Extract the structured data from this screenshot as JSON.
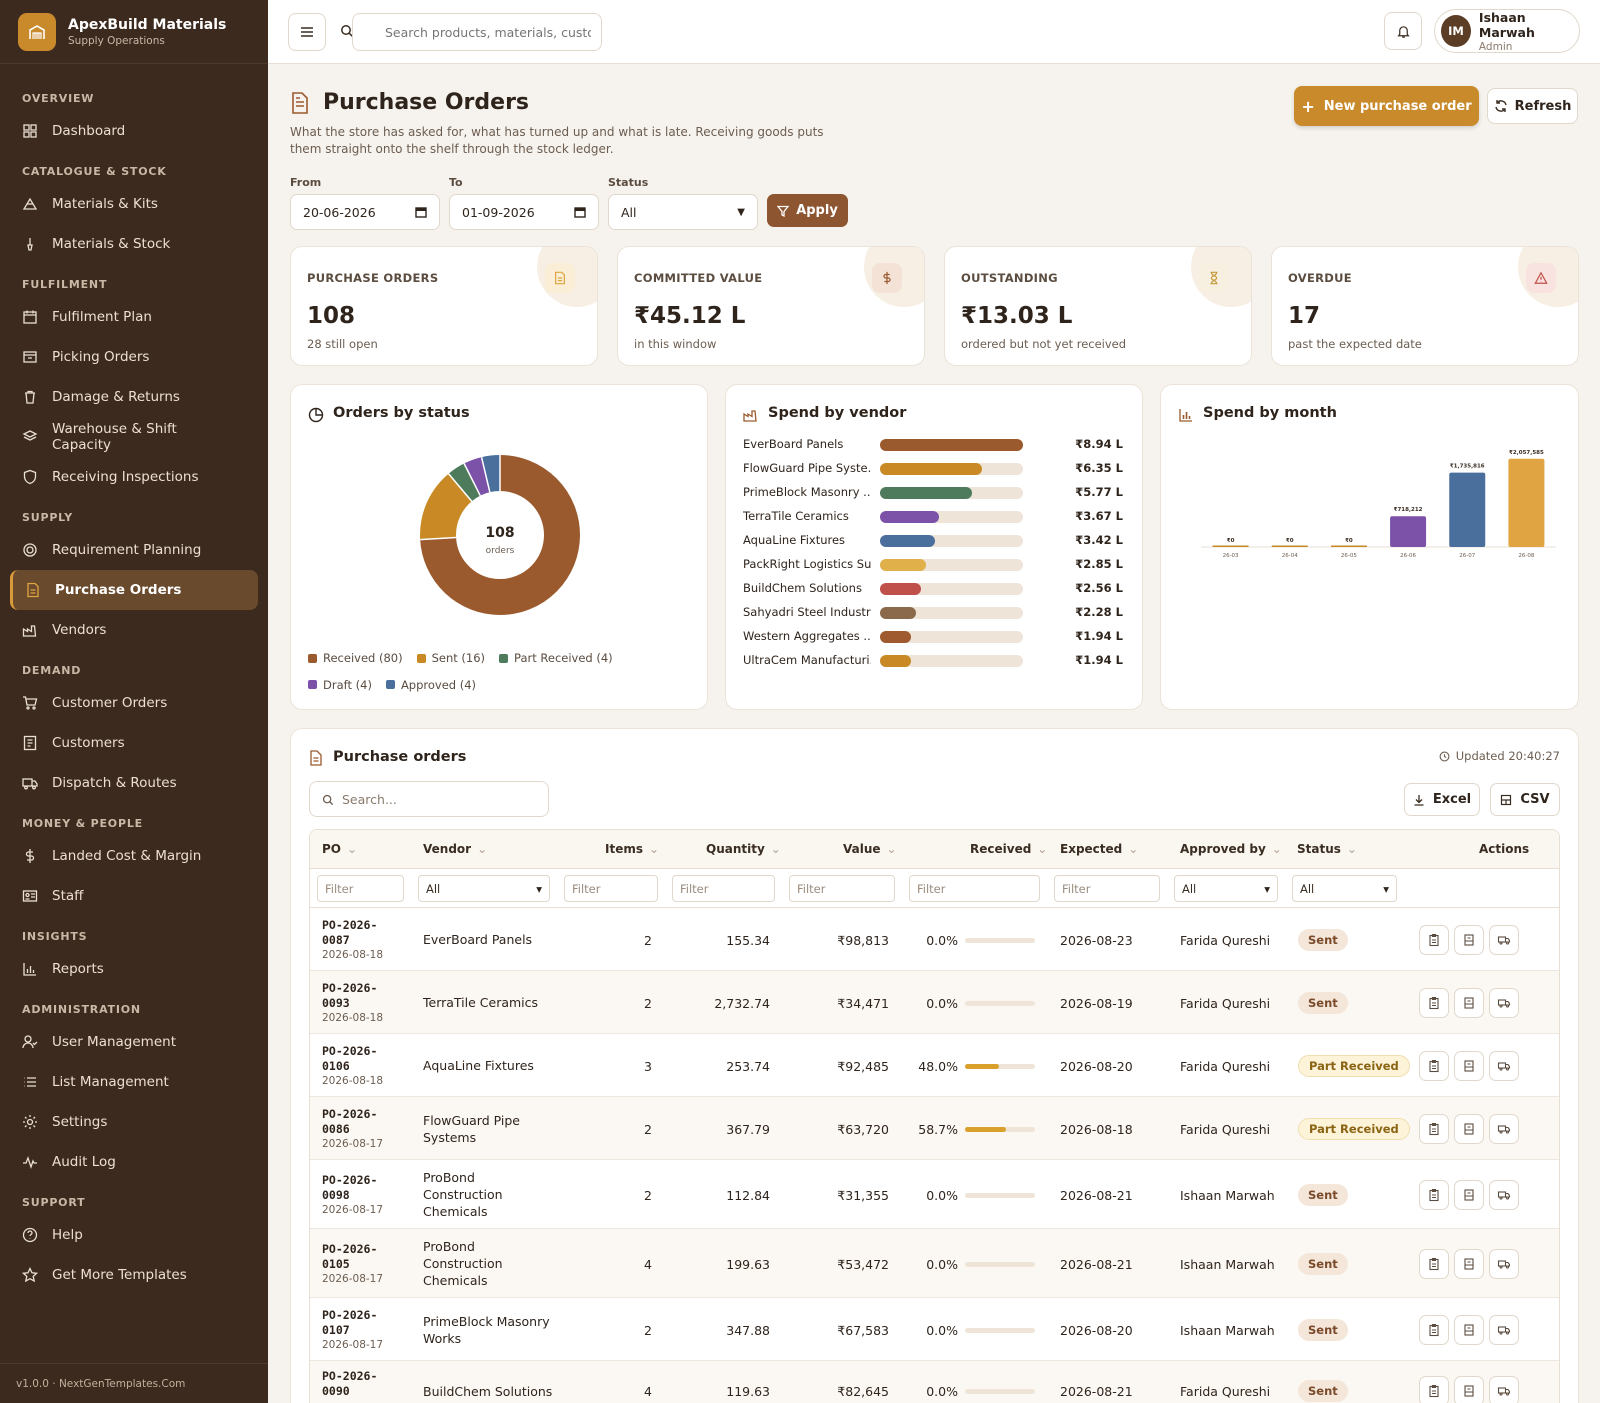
{
  "brand": {
    "name": "ApexBuild Materials",
    "subtitle": "Supply Operations"
  },
  "sidebar": {
    "sections": [
      {
        "title": "OVERVIEW",
        "items": [
          {
            "label": "Dashboard",
            "icon": "grid-icon"
          }
        ]
      },
      {
        "title": "CATALOGUE & STOCK",
        "items": [
          {
            "label": "Materials & Kits",
            "icon": "cubes-icon"
          },
          {
            "label": "Materials & Stock",
            "icon": "brush-icon"
          }
        ]
      },
      {
        "title": "FULFILMENT",
        "items": [
          {
            "label": "Fulfilment Plan",
            "icon": "calendar-icon"
          },
          {
            "label": "Picking Orders",
            "icon": "box-icon"
          },
          {
            "label": "Damage & Returns",
            "icon": "trash-icon"
          },
          {
            "label": "Warehouse & Shift Capacity",
            "icon": "layers-icon"
          },
          {
            "label": "Receiving Inspections",
            "icon": "shield-icon"
          }
        ]
      },
      {
        "title": "SUPPLY",
        "items": [
          {
            "label": "Requirement Planning",
            "icon": "target-icon"
          },
          {
            "label": "Purchase Orders",
            "icon": "document-icon",
            "active": true
          },
          {
            "label": "Vendors",
            "icon": "factory-icon"
          }
        ]
      },
      {
        "title": "DEMAND",
        "items": [
          {
            "label": "Customer Orders",
            "icon": "cart-icon"
          },
          {
            "label": "Customers",
            "icon": "contact-icon"
          },
          {
            "label": "Dispatch & Routes",
            "icon": "truck-icon"
          }
        ]
      },
      {
        "title": "MONEY & PEOPLE",
        "items": [
          {
            "label": "Landed Cost & Margin",
            "icon": "dollar-icon"
          },
          {
            "label": "Staff",
            "icon": "id-card-icon"
          }
        ]
      },
      {
        "title": "INSIGHTS",
        "items": [
          {
            "label": "Reports",
            "icon": "bar-chart-icon"
          }
        ]
      },
      {
        "title": "ADMINISTRATION",
        "items": [
          {
            "label": "User Management",
            "icon": "user-icon"
          },
          {
            "label": "List Management",
            "icon": "list-icon"
          },
          {
            "label": "Settings",
            "icon": "gear-icon"
          },
          {
            "label": "Audit Log",
            "icon": "pulse-icon"
          }
        ]
      },
      {
        "title": "SUPPORT",
        "items": [
          {
            "label": "Help",
            "icon": "help-icon"
          },
          {
            "label": "Get More Templates",
            "icon": "star-icon"
          }
        ]
      }
    ],
    "footer": "v1.0.0 · NextGenTemplates.Com"
  },
  "topbar": {
    "search_placeholder": "Search products, materials, customers",
    "user": {
      "initials": "IM",
      "name": "Ishaan Marwah",
      "role": "Admin"
    }
  },
  "page": {
    "title": "Purchase Orders",
    "description": "What the store has asked for, what has turned up and what is late. Receiving goods puts them straight onto the shelf through the stock ledger.",
    "new_button": "New purchase order",
    "refresh_button": "Refresh"
  },
  "filters": {
    "from_label": "From",
    "from_value": "20-06-2026",
    "to_label": "To",
    "to_value": "01-09-2026",
    "status_label": "Status",
    "status_value": "All",
    "apply_button": "Apply"
  },
  "kpis": [
    {
      "label": "PURCHASE ORDERS",
      "value": "108",
      "sub": "28 still open",
      "icon": "document-icon",
      "icon_color": "#e0a542",
      "icon_bg": "#fbeed6"
    },
    {
      "label": "COMMITTED VALUE",
      "value": "₹45.12 L",
      "sub": "in this window",
      "icon": "dollar-icon",
      "icon_color": "#9a5b32",
      "icon_bg": "#f4e2d6"
    },
    {
      "label": "OUTSTANDING",
      "value": "₹13.03 L",
      "sub": "ordered but not yet received",
      "icon": "hourglass-icon",
      "icon_color": "#c49a3c",
      "icon_bg": "#f7efe0"
    },
    {
      "label": "OVERDUE",
      "value": "17",
      "sub": "past the expected date",
      "icon": "warning-icon",
      "icon_color": "#c0504a",
      "icon_bg": "#f9e3e0"
    }
  ],
  "status_chart": {
    "title": "Orders by status",
    "center_value": "108",
    "center_label": "orders",
    "chart_data": {
      "type": "pie",
      "labels": [
        "Received",
        "Sent",
        "Part Received",
        "Draft",
        "Approved"
      ],
      "values": [
        80,
        16,
        4,
        4,
        4
      ],
      "colors": [
        "#9b5a2e",
        "#c98a25",
        "#4e7b5c",
        "#7b52a8",
        "#4a6f9c"
      ]
    },
    "legend": [
      "Received (80)",
      "Sent (16)",
      "Part Received (4)",
      "Draft (4)",
      "Approved (4)"
    ]
  },
  "vendor_chart": {
    "title": "Spend by vendor",
    "chart_data": {
      "type": "bar",
      "categories": [
        "EverBoard Panels",
        "FlowGuard Pipe Syste...",
        "PrimeBlock Masonry ...",
        "TerraTile Ceramics",
        "AquaLine Fixtures",
        "PackRight Logistics Su...",
        "BuildChem Solutions",
        "Sahyadri Steel Industri...",
        "Western Aggregates ...",
        "UltraCem Manufacturi..."
      ],
      "values": [
        8.94,
        6.35,
        5.77,
        3.67,
        3.42,
        2.85,
        2.56,
        2.28,
        1.94,
        1.94
      ],
      "labels": [
        "₹8.94 L",
        "₹6.35 L",
        "₹5.77 L",
        "₹3.67 L",
        "₹3.42 L",
        "₹2.85 L",
        "₹2.56 L",
        "₹2.28 L",
        "₹1.94 L",
        "₹1.94 L"
      ],
      "colors": [
        "#9b5a2e",
        "#c98a25",
        "#4e7b5c",
        "#7b52a8",
        "#4a6f9c",
        "#e0b04a",
        "#c0504a",
        "#8a6a4a",
        "#a05a30",
        "#c98a25"
      ]
    }
  },
  "month_chart": {
    "title": "Spend by month",
    "chart_data": {
      "type": "bar",
      "categories": [
        "26-03",
        "26-04",
        "26-05",
        "26-06",
        "26-07",
        "26-08"
      ],
      "values": [
        0,
        0,
        0,
        718212,
        1735816,
        2057585
      ],
      "labels": [
        "₹0",
        "₹0",
        "₹0",
        "₹718,212",
        "₹1,735,816",
        "₹2,057,585"
      ],
      "colors": [
        "#c98a25",
        "#c98a25",
        "#c98a25",
        "#7b52a8",
        "#4a6f9c",
        "#e0a542"
      ]
    }
  },
  "table": {
    "title": "Purchase orders",
    "updated": "Updated 20:40:27",
    "search_placeholder": "Search...",
    "excel_button": "Excel",
    "csv_button": "CSV",
    "columns": [
      "PO",
      "Vendor",
      "Items",
      "Quantity",
      "Value",
      "Received",
      "Expected",
      "Approved by",
      "Status",
      "Actions"
    ],
    "filter_placeholder": "Filter",
    "filter_all": "All",
    "rows": [
      {
        "po1": "PO-2026-",
        "po2": "0087",
        "date": "2026-08-18",
        "vendor": [
          "EverBoard Panels"
        ],
        "items": "2",
        "qty": "155.34",
        "value": "₹98,813",
        "received": "0.0%",
        "received_frac": 0,
        "expected": "2026-08-23",
        "approver": "Farida Qureshi",
        "status": "Sent"
      },
      {
        "po1": "PO-2026-",
        "po2": "0093",
        "date": "2026-08-18",
        "vendor": [
          "TerraTile Ceramics"
        ],
        "items": "2",
        "qty": "2,732.74",
        "value": "₹34,471",
        "received": "0.0%",
        "received_frac": 0,
        "expected": "2026-08-19",
        "approver": "Farida Qureshi",
        "status": "Sent"
      },
      {
        "po1": "PO-2026-",
        "po2": "0106",
        "date": "2026-08-18",
        "vendor": [
          "AquaLine Fixtures"
        ],
        "items": "3",
        "qty": "253.74",
        "value": "₹92,485",
        "received": "48.0%",
        "received_frac": 0.48,
        "expected": "2026-08-20",
        "approver": "Farida Qureshi",
        "status": "Part Received"
      },
      {
        "po1": "PO-2026-",
        "po2": "0086",
        "date": "2026-08-17",
        "vendor": [
          "FlowGuard Pipe",
          "Systems"
        ],
        "items": "2",
        "qty": "367.79",
        "value": "₹63,720",
        "received": "58.7%",
        "received_frac": 0.587,
        "expected": "2026-08-18",
        "approver": "Farida Qureshi",
        "status": "Part Received"
      },
      {
        "po1": "PO-2026-",
        "po2": "0098",
        "date": "2026-08-17",
        "vendor": [
          "ProBond",
          "Construction",
          "Chemicals"
        ],
        "items": "2",
        "qty": "112.84",
        "value": "₹31,355",
        "received": "0.0%",
        "received_frac": 0,
        "expected": "2026-08-21",
        "approver": "Ishaan Marwah",
        "status": "Sent"
      },
      {
        "po1": "PO-2026-",
        "po2": "0105",
        "date": "2026-08-17",
        "vendor": [
          "ProBond",
          "Construction",
          "Chemicals"
        ],
        "items": "4",
        "qty": "199.63",
        "value": "₹53,472",
        "received": "0.0%",
        "received_frac": 0,
        "expected": "2026-08-21",
        "approver": "Ishaan Marwah",
        "status": "Sent"
      },
      {
        "po1": "PO-2026-",
        "po2": "0107",
        "date": "2026-08-17",
        "vendor": [
          "PrimeBlock Masonry",
          "Works"
        ],
        "items": "2",
        "qty": "347.88",
        "value": "₹67,583",
        "received": "0.0%",
        "received_frac": 0,
        "expected": "2026-08-20",
        "approver": "Ishaan Marwah",
        "status": "Sent"
      },
      {
        "po1": "PO-2026-",
        "po2": "0090",
        "date": "",
        "vendor": [
          "BuildChem Solutions"
        ],
        "items": "4",
        "qty": "119.63",
        "value": "₹82,645",
        "received": "0.0%",
        "received_frac": 0,
        "expected": "2026-08-21",
        "approver": "Farida Qureshi",
        "status": "Sent"
      }
    ]
  }
}
